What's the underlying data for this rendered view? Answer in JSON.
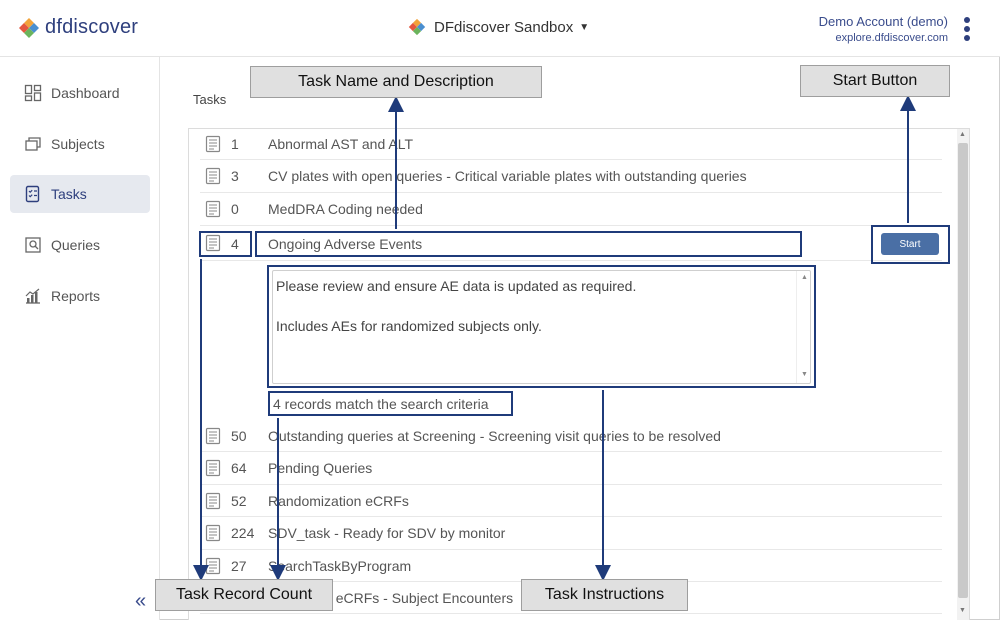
{
  "header": {
    "logo_text": "dfdiscover",
    "study_name": "DFdiscover Sandbox",
    "account_name": "Demo Account (demo)",
    "account_host": "explore.dfdiscover.com"
  },
  "sidebar": {
    "items": [
      {
        "label": "Dashboard",
        "icon": "dashboard-icon"
      },
      {
        "label": "Subjects",
        "icon": "subjects-icon"
      },
      {
        "label": "Tasks",
        "icon": "tasks-icon",
        "active": true
      },
      {
        "label": "Queries",
        "icon": "queries-icon"
      },
      {
        "label": "Reports",
        "icon": "reports-icon"
      }
    ],
    "collapse_glyph": "«"
  },
  "main": {
    "title": "Tasks",
    "tasks": [
      {
        "count": "1",
        "name": "Abnormal AST and ALT"
      },
      {
        "count": "3",
        "name": "CV plates with open queries - Critical variable plates with outstanding queries"
      },
      {
        "count": "0",
        "name": "MedDRA Coding needed"
      },
      {
        "count": "4",
        "name": "Ongoing Adverse Events"
      },
      {
        "count": "50",
        "name": "Outstanding queries at Screening - Screening visit queries to be resolved"
      },
      {
        "count": "64",
        "name": "Pending Queries"
      },
      {
        "count": "52",
        "name": "Randomization eCRFs"
      },
      {
        "count": "224",
        "name": "SDV_task - Ready for SDV by monitor"
      },
      {
        "count": "27",
        "name": "SearchTaskByProgram"
      },
      {
        "count": "",
        "name": "Encounter eCRFs - Subject Encounters"
      }
    ],
    "start_label": "Start",
    "instructions": {
      "line1": "Please review and ensure AE data is updated as required.",
      "line2": "Includes AEs for randomized subjects only."
    },
    "match_text": "4 records match the search criteria"
  },
  "annotations": {
    "task_name": "Task Name and Description",
    "start_button": "Start Button",
    "record_count": "Task Record Count",
    "instructions": "Task Instructions"
  },
  "colors": {
    "brand": "#2e3f7d",
    "start_button": "#4a6fa5",
    "callout_outline": "#1f3b7a",
    "active_nav": "#e6e9ef"
  }
}
